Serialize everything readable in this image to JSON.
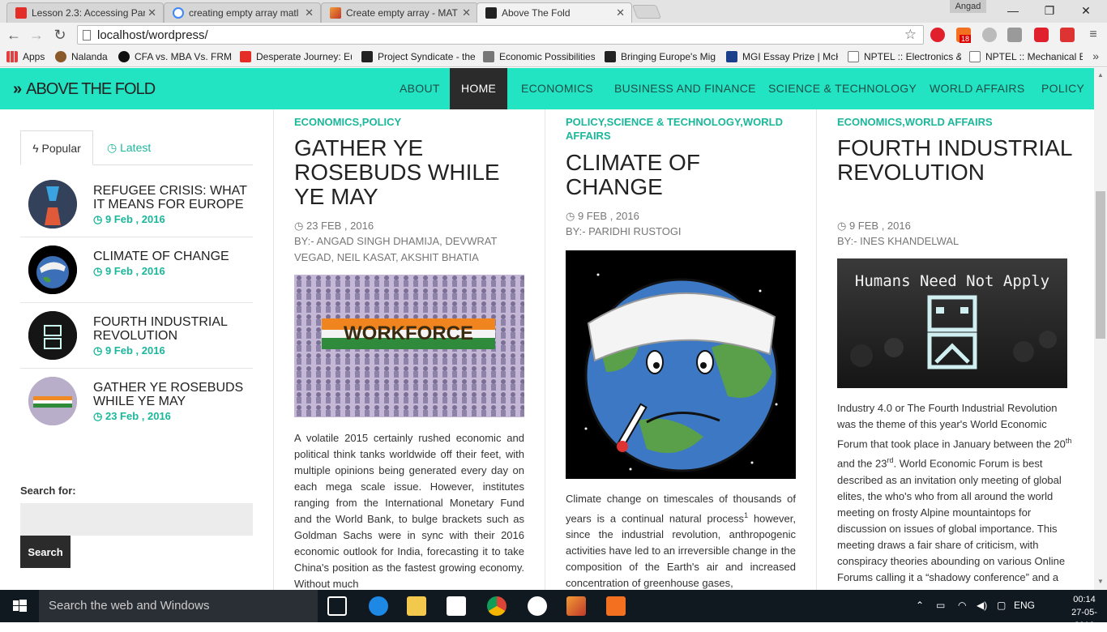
{
  "browser": {
    "tabs": [
      {
        "label": "Lesson 2.3: Accessing Part",
        "favicon": "youtube-icon",
        "color": "#e52d27"
      },
      {
        "label": "creating empty array matl",
        "favicon": "google-icon",
        "color": "#4285f4"
      },
      {
        "label": "Create empty array - MAT",
        "favicon": "matlab-icon",
        "color": "#d9531e"
      },
      {
        "label": "Above The Fold",
        "favicon": "site-icon",
        "color": "#222222"
      }
    ],
    "user": "Angad",
    "url": "localhost/wordpress/",
    "bookmarks": [
      "Apps",
      "Nalanda",
      "CFA vs. MBA Vs. FRM:",
      "Desperate Journey: Eu",
      "Project Syndicate - the",
      "Economic Possibilities",
      "Bringing Europe's Mig",
      "MGI Essay Prize | McK",
      "NPTEL :: Electronics &",
      "NPTEL :: Mechanical E"
    ],
    "badge": "18"
  },
  "site": {
    "logo": "ABOVE THE FOLD",
    "accent": "#22e3c2",
    "nav": [
      "ABOUT",
      "HOME",
      "ECONOMICS",
      "BUSINESS AND FINANCE",
      "SCIENCE & TECHNOLOGY",
      "WORLD AFFAIRS",
      "POLICY"
    ]
  },
  "sidebar": {
    "tab_popular": "Popular",
    "tab_latest": "Latest",
    "items": [
      {
        "title": "REFUGEE CRISIS: WHAT IT MEANS FOR EUROPE",
        "date": "9 Feb , 2016"
      },
      {
        "title": "CLIMATE OF CHANGE",
        "date": "9 Feb , 2016"
      },
      {
        "title": "FOURTH INDUSTRIAL REVOLUTION",
        "date": "9 Feb , 2016"
      },
      {
        "title": "GATHER YE ROSEBUDS WHILE YE MAY",
        "date": "23 Feb , 2016"
      }
    ],
    "search_label": "Search for:",
    "search_placeholder": "",
    "search_button": "Search"
  },
  "articles": [
    {
      "cats": "ECONOMICS,POLICY",
      "title": "GATHER YE ROSEBUDS WHILE YE MAY",
      "date": "23 FEB , 2016",
      "author": "BY:- ANGAD SINGH DHAMIJA, DEVWRAT VEGAD, NEIL KASAT, AKSHIT BHATIA",
      "image_text": "WORKFORCE",
      "excerpt": "A volatile 2015 certainly rushed economic and political think tanks worldwide off their feet, with multiple opinions being generated every day on each mega scale issue. However, institutes ranging from the International Monetary Fund and the World Bank, to bulge brackets such as Goldman Sachs were in sync with their 2016 economic outlook for India, forecasting it to take China's position as the fastest growing economy. Without much"
    },
    {
      "cats": "POLICY,SCIENCE & TECHNOLOGY,WORLD AFFAIRS",
      "title": "CLIMATE OF CHANGE",
      "date": "9 FEB , 2016",
      "author": "BY:- PARIDHI RUSTOGI",
      "excerpt_a": "Climate change on timescales of thousands of years is a continual natural process",
      "excerpt_sup": "1",
      "excerpt_b": " however, since the industrial revolution, anthropogenic activities have led to an irreversible change in the composition of the Earth's air and increased concentration of greenhouse gases,"
    },
    {
      "cats": "ECONOMICS,WORLD AFFAIRS",
      "title": "FOURTH INDUSTRIAL REVOLUTION",
      "date": "9 FEB , 2016",
      "author": "BY:- INES KHANDELWAL",
      "image_text": "Humans Need Not Apply",
      "excerpt_a": "Industry 4.0 or The Fourth Industrial Revolution was the theme of this year's World Economic Forum that took place in January between the 20",
      "sup1": "th",
      "excerpt_b": " and the 23",
      "sup2": "rd",
      "excerpt_c": ". World Economic Forum is best described as an invitation only meeting of global elites, the who's who from all around the world meeting on frosty Alpine mountaintops for discussion on issues of global importance. This meeting draws a fair share of criticism, with conspiracy theories abounding on various Online Forums calling it a “shadowy conference” and a “means"
    }
  ],
  "taskbar": {
    "search": "Search the web and Windows",
    "lang": "ENG",
    "time": "00:14",
    "date": "27-05-2016"
  }
}
